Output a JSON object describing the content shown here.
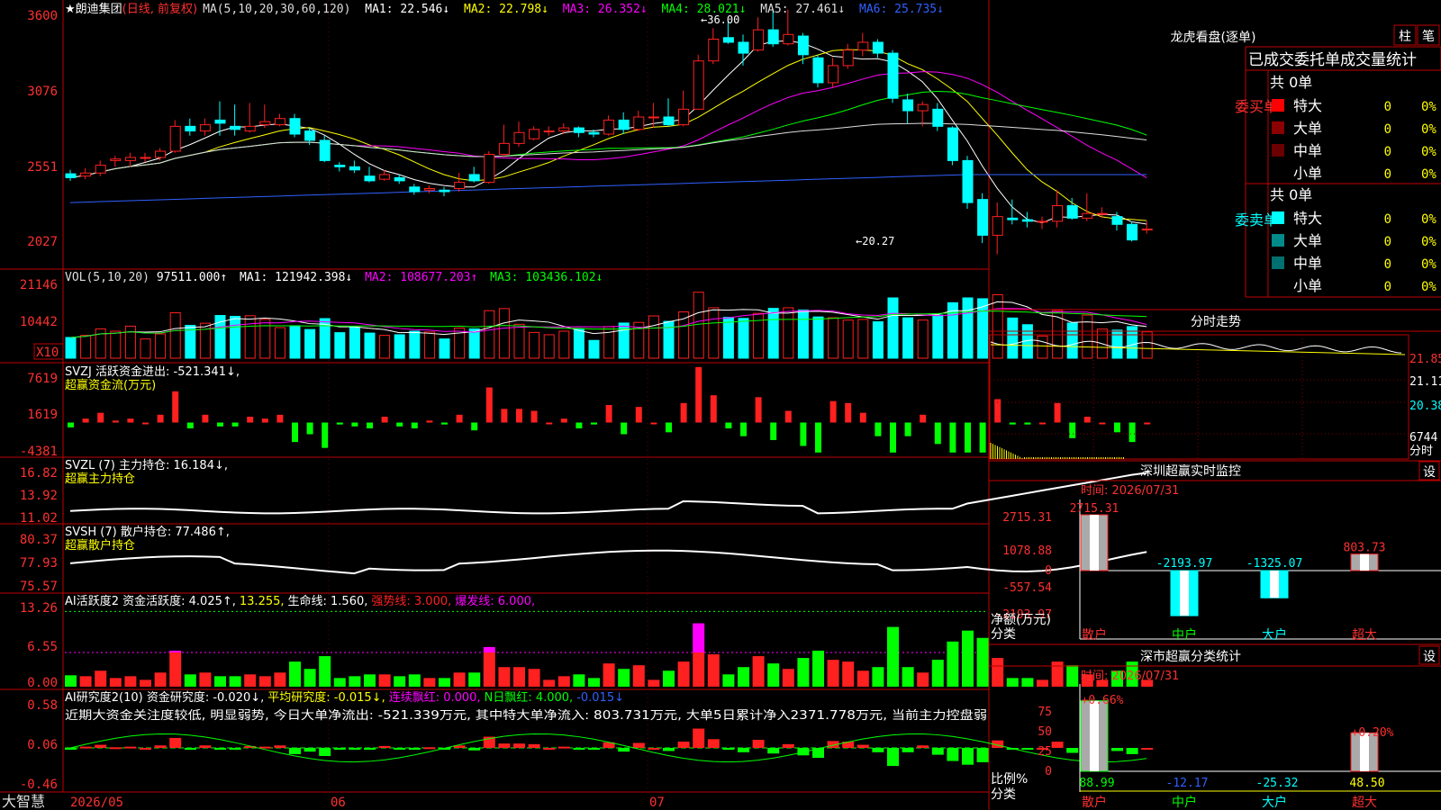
{
  "stock": {
    "name": "★朗迪集团",
    "mode": "(日线, 前复权)"
  },
  "colors": {
    "up": "#ff2020",
    "down": "#00ffff",
    "panel_line": "#c00000",
    "bg": "#000000",
    "green": "#00ff00",
    "yellow": "#ffff00",
    "magenta": "#ff00ff",
    "white": "#ffffff"
  },
  "main_panel": {
    "ma_header": "MA(5,10,20,30,60,120)",
    "ma": [
      {
        "label": "MA1: 22.546↓",
        "color": "#ffffff"
      },
      {
        "label": "MA2: 22.798↓",
        "color": "#ffff00"
      },
      {
        "label": "MA3: 26.352↓",
        "color": "#ff00ff"
      },
      {
        "label": "MA4: 28.021↓",
        "color": "#00ff00"
      },
      {
        "label": "MA5: 27.461↓",
        "color": "#dddddd"
      },
      {
        "label": "MA6: 25.735↓",
        "color": "#3060ff"
      }
    ],
    "y_ticks": [
      "3600",
      "3076",
      "2551",
      "2027"
    ],
    "high_marker": "36.00",
    "low_marker": "←20.27"
  },
  "vol_panel": {
    "header": "VOL(5,10,20)",
    "value": "97511.000↑",
    "ma": [
      {
        "label": "MA1: 121942.398↓",
        "color": "#ffffff"
      },
      {
        "label": "MA2: 108677.203↑",
        "color": "#ff00ff"
      },
      {
        "label": "MA3: 103436.102↓",
        "color": "#00ff00"
      }
    ],
    "y_ticks": [
      "21146",
      "10442"
    ],
    "unit": "X10"
  },
  "svzj_panel": {
    "title": "SVZJ  活跃资金进出: -521.341↓,",
    "subtitle": "超赢资金流(万元)",
    "y_ticks": [
      "7619",
      "1619",
      "-4381"
    ]
  },
  "svzl_panel": {
    "title": "SVZL (7) 主力持仓: 16.184↓,",
    "subtitle": "超赢主力持仓",
    "y_ticks": [
      "16.82",
      "13.92",
      "11.02"
    ]
  },
  "svsh_panel": {
    "title": "SVSH (7) 散户持仓: 77.486↑,",
    "subtitle": "超赢散户持仓",
    "y_ticks": [
      "80.37",
      "77.93",
      "75.57"
    ]
  },
  "ai_active_panel": {
    "title": "AI活跃度2 资金活跃度: 4.025↑,",
    "v2": "13.255,",
    "life": "生命线: 1.560,",
    "strong": "强势线: 3.000,",
    "burst": "爆发线: 6.000,",
    "y_ticks": [
      "13.26",
      "6.55",
      "0.00"
    ]
  },
  "ai_research_panel": {
    "title": "AI研究度2(10) 资金研究度: -0.020↓,",
    "avg": "平均研究度: -0.015↓,",
    "lianxu": "连续飘红: 0.000,",
    "nday": "N日飘红: 4.000,",
    "last": "-0.015↓",
    "comment": "近期大资金关注度较低, 明显弱势, 今日大单净流出: -521.339万元, 其中特大单净流入: 803.731万元, 大单5日累计净入2371.778万元, 当前主力控盘弱",
    "y_ticks": [
      "0.58",
      "0.06",
      "-0.46"
    ]
  },
  "bottom_bar": {
    "brand": "大智慧",
    "dates": [
      "2026/05",
      "06",
      "07"
    ]
  },
  "right": {
    "lhb": {
      "title": "龙虎看盘(逐单)",
      "btn1": "柱",
      "btn2": "笔",
      "header": "已成交委托单成交量统计"
    },
    "buy": {
      "side": "委买单",
      "total": "共 0单",
      "rows": [
        {
          "label": "特大",
          "count": "0",
          "pct": "0%",
          "color": "#ff0000"
        },
        {
          "label": "大单",
          "count": "0",
          "pct": "0%",
          "color": "#8b0000"
        },
        {
          "label": "中单",
          "count": "0",
          "pct": "0%",
          "color": "#6a0000"
        },
        {
          "label": "小单",
          "count": "0",
          "pct": "0%",
          "color": "#000000"
        }
      ]
    },
    "sell": {
      "side": "委卖单",
      "total": "共 0单",
      "rows": [
        {
          "label": "特大",
          "count": "0",
          "pct": "0%",
          "color": "#00ffff"
        },
        {
          "label": "大单",
          "count": "0",
          "pct": "0%",
          "color": "#008b8b"
        },
        {
          "label": "中单",
          "count": "0",
          "pct": "0%",
          "color": "#007070"
        },
        {
          "label": "小单",
          "count": "0",
          "pct": "0%",
          "color": "#000000"
        }
      ]
    },
    "intraday": {
      "title": "分时走势",
      "prices": [
        "21.85",
        "21.11",
        "20.38"
      ],
      "vol": "6744",
      "vol_unit": "分时"
    },
    "monitor": {
      "title": "深圳超赢实时监控",
      "btn": "设",
      "time": "时间: 2026/07/31",
      "y_ticks": [
        "2715.31",
        "1078.88",
        "0",
        "-557.54",
        "-2193.97"
      ],
      "bars": [
        {
          "cat": "散户",
          "value": 2715.31,
          "label": "2715.31"
        },
        {
          "cat": "中户",
          "value": -2193.97,
          "label": "-2193.97"
        },
        {
          "cat": "大户",
          "value": -1325.07,
          "label": "-1325.07"
        },
        {
          "cat": "超大",
          "value": 803.73,
          "label": "803.73"
        }
      ],
      "axis_title": "净额(万元)",
      "axis_sub": "分类"
    },
    "classify": {
      "title": "深市超赢分类统计",
      "btn": "设",
      "time": "时间: 2026/07/31",
      "y_ticks": [
        "75",
        "50",
        "25",
        "0"
      ],
      "bars": [
        {
          "cat": "散户",
          "top": "+0.66%",
          "value": 88.99,
          "label": "88.99"
        },
        {
          "cat": "中户",
          "top": "",
          "value": -12.17,
          "label": "-12.17"
        },
        {
          "cat": "大户",
          "top": "",
          "value": -25.32,
          "label": "-25.32"
        },
        {
          "cat": "超大",
          "top": "+0.20%",
          "value": 48.5,
          "label": "48.50"
        }
      ],
      "axis_title": "比例%",
      "axis_sub": "分类"
    }
  },
  "chart_data": {
    "type": "candlestick",
    "candles": [
      [
        25.45,
        25.2,
        25.7,
        25.0
      ],
      [
        25.3,
        25.5,
        25.8,
        25.1
      ],
      [
        25.5,
        26.0,
        26.3,
        25.3
      ],
      [
        26.3,
        26.4,
        26.6,
        25.9
      ],
      [
        26.3,
        26.5,
        26.8,
        25.9
      ],
      [
        26.5,
        26.5,
        26.8,
        26.2
      ],
      [
        26.5,
        26.9,
        27.1,
        26.3
      ],
      [
        26.9,
        28.5,
        28.9,
        26.8
      ],
      [
        28.5,
        28.2,
        29.0,
        27.9
      ],
      [
        28.2,
        28.6,
        29.0,
        27.9
      ],
      [
        28.9,
        28.7,
        30.1,
        27.9
      ],
      [
        28.5,
        28.3,
        29.9,
        27.9
      ],
      [
        28.2,
        28.5,
        30.0,
        28.1
      ],
      [
        28.6,
        28.8,
        29.9,
        28.4
      ],
      [
        28.6,
        29.0,
        29.3,
        28.5
      ],
      [
        29.0,
        28.0,
        29.3,
        27.8
      ],
      [
        28.2,
        27.6,
        28.4,
        27.3
      ],
      [
        27.6,
        26.3,
        27.9,
        26.2
      ],
      [
        26.0,
        25.9,
        26.2,
        25.6
      ],
      [
        25.9,
        25.7,
        26.3,
        25.5
      ],
      [
        25.3,
        25.0,
        25.9,
        24.9
      ],
      [
        25.1,
        25.4,
        25.7,
        25.0
      ],
      [
        25.2,
        25.0,
        25.4,
        24.8
      ],
      [
        24.6,
        24.3,
        24.8,
        24.1
      ],
      [
        24.4,
        24.5,
        24.7,
        24.2
      ],
      [
        24.4,
        24.3,
        24.6,
        24.0
      ],
      [
        24.5,
        24.9,
        25.5,
        24.3
      ],
      [
        25.4,
        25.0,
        25.9,
        24.9
      ],
      [
        24.9,
        26.7,
        26.9,
        24.8
      ],
      [
        26.7,
        27.4,
        28.6,
        26.5
      ],
      [
        27.4,
        28.1,
        28.8,
        27.2
      ],
      [
        27.7,
        28.3,
        28.5,
        27.6
      ],
      [
        28.2,
        28.2,
        28.5,
        27.9
      ],
      [
        28.2,
        28.4,
        28.7,
        28.0
      ],
      [
        28.4,
        28.1,
        28.5,
        27.8
      ],
      [
        28.1,
        28.0,
        28.3,
        27.8
      ],
      [
        28.0,
        28.9,
        29.2,
        27.9
      ],
      [
        28.9,
        28.3,
        29.4,
        28.0
      ],
      [
        28.3,
        29.1,
        29.5,
        28.2
      ],
      [
        29.1,
        29.1,
        30.0,
        28.4
      ],
      [
        29.1,
        28.6,
        30.3,
        28.5
      ],
      [
        28.6,
        29.6,
        30.8,
        28.5
      ],
      [
        29.6,
        32.7,
        33.1,
        29.6
      ],
      [
        32.7,
        34.1,
        34.8,
        32.5
      ],
      [
        34.2,
        33.9,
        35.3,
        33.8
      ],
      [
        33.9,
        33.2,
        34.4,
        32.4
      ],
      [
        33.4,
        34.7,
        35.5,
        33.3
      ],
      [
        34.7,
        33.8,
        36.0,
        33.6
      ],
      [
        33.8,
        34.4,
        36.0,
        33.7
      ],
      [
        34.3,
        33.1,
        34.5,
        32.5
      ],
      [
        32.9,
        31.3,
        33.1,
        31.0
      ],
      [
        31.3,
        32.4,
        32.9,
        31.0
      ],
      [
        32.4,
        33.4,
        33.8,
        32.2
      ],
      [
        33.4,
        33.9,
        34.5,
        33.0
      ],
      [
        33.9,
        33.2,
        34.1,
        32.9
      ],
      [
        33.2,
        30.3,
        33.4,
        30.0
      ],
      [
        30.2,
        29.5,
        30.6,
        28.7
      ],
      [
        29.5,
        29.9,
        30.1,
        28.5
      ],
      [
        29.6,
        28.5,
        30.0,
        28.2
      ],
      [
        28.4,
        26.3,
        28.5,
        26.0
      ],
      [
        26.3,
        23.6,
        26.6,
        23.2
      ],
      [
        23.8,
        21.5,
        24.2,
        21.0
      ],
      [
        21.5,
        22.7,
        23.6,
        20.27
      ],
      [
        22.6,
        22.5,
        23.8,
        22.2
      ],
      [
        22.5,
        22.4,
        23.0,
        22.0
      ],
      [
        22.4,
        22.4,
        22.7,
        21.9
      ],
      [
        22.4,
        23.4,
        24.4,
        22.0
      ],
      [
        23.4,
        22.6,
        23.9,
        22.5
      ],
      [
        22.6,
        22.9,
        24.2,
        22.4
      ],
      [
        22.9,
        22.9,
        23.3,
        22.6
      ],
      [
        22.7,
        22.2,
        23.0,
        21.8
      ],
      [
        22.2,
        21.2,
        22.4,
        21.1
      ],
      [
        21.9,
        21.9,
        22.4,
        21.6
      ]
    ],
    "y_range": [
      19.5,
      36.5
    ],
    "volume_range": [
      0,
      21146
    ],
    "svzj_range": [
      -4381,
      7619
    ],
    "svzl_range": [
      11.02,
      16.82
    ],
    "svsh_range": [
      75.57,
      80.37
    ],
    "active_range": [
      0,
      13.26
    ],
    "research_range": [
      -0.46,
      0.58
    ]
  }
}
